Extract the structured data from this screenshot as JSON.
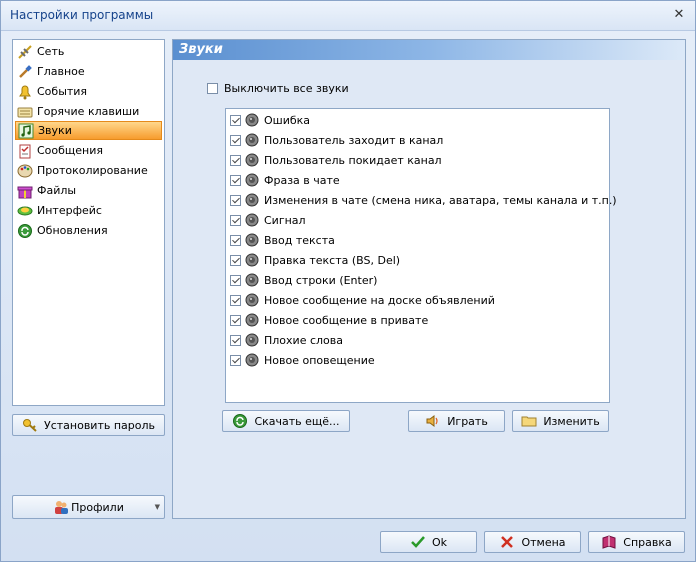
{
  "window": {
    "title": "Настройки программы",
    "close_glyph": "✕"
  },
  "nav": {
    "items": [
      {
        "label": "Сеть",
        "icon": "network-icon",
        "active": false
      },
      {
        "label": "Главное",
        "icon": "brush-icon",
        "active": false
      },
      {
        "label": "События",
        "icon": "bell-icon",
        "active": false
      },
      {
        "label": "Горячие клавиши",
        "icon": "keyboard-icon",
        "active": false
      },
      {
        "label": "Звуки",
        "icon": "music-note-icon",
        "active": true
      },
      {
        "label": "Сообщения",
        "icon": "clipboard-icon",
        "active": false
      },
      {
        "label": "Протоколирование",
        "icon": "palette-icon",
        "active": false
      },
      {
        "label": "Файлы",
        "icon": "gift-icon",
        "active": false
      },
      {
        "label": "Интерфейс",
        "icon": "interface-icon",
        "active": false
      },
      {
        "label": "Обновления",
        "icon": "update-icon",
        "active": false
      }
    ]
  },
  "left_buttons": {
    "set_password": "Установить пароль",
    "profiles": "Профили"
  },
  "content": {
    "header": "Звуки",
    "mute_all": {
      "label": "Выключить все звуки",
      "checked": false
    },
    "sounds": [
      {
        "label": "Ошибка",
        "checked": true
      },
      {
        "label": "Пользователь заходит в канал",
        "checked": true
      },
      {
        "label": "Пользователь покидает канал",
        "checked": true
      },
      {
        "label": "Фраза в чате",
        "checked": true
      },
      {
        "label": "Изменения в чате (смена ника, аватара, темы канала и т.п.)",
        "checked": true
      },
      {
        "label": "Сигнал",
        "checked": true
      },
      {
        "label": "Ввод текста",
        "checked": true
      },
      {
        "label": "Правка текста (BS, Del)",
        "checked": true
      },
      {
        "label": "Ввод строки (Enter)",
        "checked": true
      },
      {
        "label": "Новое сообщение на доске объявлений",
        "checked": true
      },
      {
        "label": "Новое сообщение в привате",
        "checked": true
      },
      {
        "label": "Плохие слова",
        "checked": true
      },
      {
        "label": "Новое оповещение",
        "checked": true
      }
    ],
    "buttons": {
      "download_more": "Скачать ещё...",
      "play": "Играть",
      "change": "Изменить"
    }
  },
  "footer": {
    "ok": "Ok",
    "cancel": "Отмена",
    "help": "Справка"
  },
  "colors": {
    "accent": "#f79c2e",
    "header_blue": "#5a8fd0",
    "border": "#8ea7c6"
  }
}
